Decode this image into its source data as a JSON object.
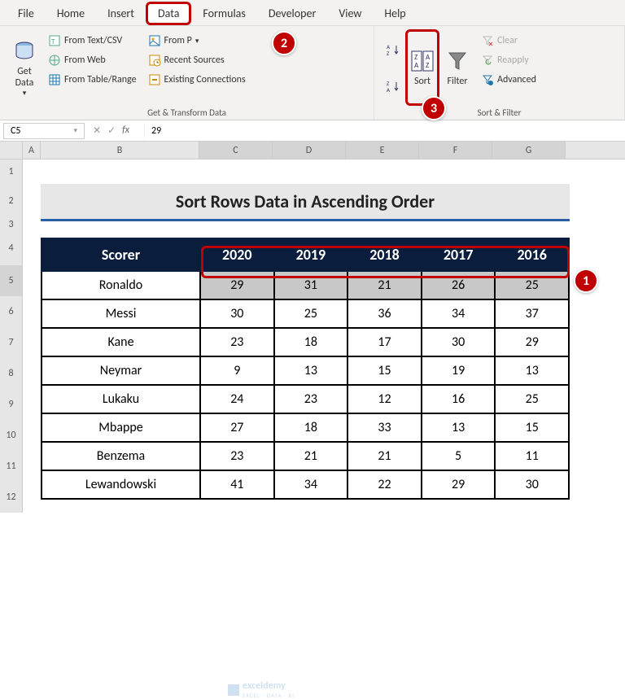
{
  "tabs": {
    "file": "File",
    "home": "Home",
    "insert": "Insert",
    "data": "Data",
    "formulas": "Formulas",
    "developer": "Developer",
    "view": "View",
    "help": "Help"
  },
  "ribbon": {
    "get_data": "Get\nData",
    "from_text_csv": "From Text/CSV",
    "from_web": "From Web",
    "from_table_range": "From Table/Range",
    "from_p": "From P",
    "recent_sources": "Recent Sources",
    "existing_connections": "Existing Connections",
    "group1_label": "Get & Transform Data",
    "sort_az": "A→Z",
    "sort_za": "Z→A",
    "sort": "Sort",
    "filter": "Filter",
    "clear": "Clear",
    "reapply": "Reapply",
    "advanced": "Advanced",
    "group2_label": "Sort & Filter"
  },
  "callouts": {
    "c1": "1",
    "c2": "2",
    "c3": "3"
  },
  "formula": {
    "name_box": "C5",
    "cancel": "✕",
    "enter": "✓",
    "fx": "fx",
    "value": "29"
  },
  "columns": [
    "A",
    "B",
    "C",
    "D",
    "E",
    "F",
    "G"
  ],
  "row_numbers": [
    "1",
    "2",
    "3",
    "4",
    "5",
    "6",
    "7",
    "8",
    "9",
    "10",
    "11",
    "12"
  ],
  "title": "Sort Rows Data in Ascending Order",
  "headers": [
    "Scorer",
    "2020",
    "2019",
    "2018",
    "2017",
    "2016"
  ],
  "rows": [
    [
      "Ronaldo",
      "29",
      "31",
      "21",
      "26",
      "25"
    ],
    [
      "Messi",
      "30",
      "25",
      "36",
      "34",
      "37"
    ],
    [
      "Kane",
      "23",
      "18",
      "17",
      "30",
      "29"
    ],
    [
      "Neymar",
      "9",
      "13",
      "15",
      "19",
      "13"
    ],
    [
      "Lukaku",
      "24",
      "23",
      "12",
      "16",
      "25"
    ],
    [
      "Mbappe",
      "27",
      "18",
      "33",
      "13",
      "15"
    ],
    [
      "Benzema",
      "23",
      "21",
      "21",
      "5",
      "11"
    ],
    [
      "Lewandowski",
      "41",
      "34",
      "22",
      "29",
      "30"
    ]
  ],
  "watermark": "exceldemy",
  "watermark_sub": "EXCEL · DATA · BI"
}
